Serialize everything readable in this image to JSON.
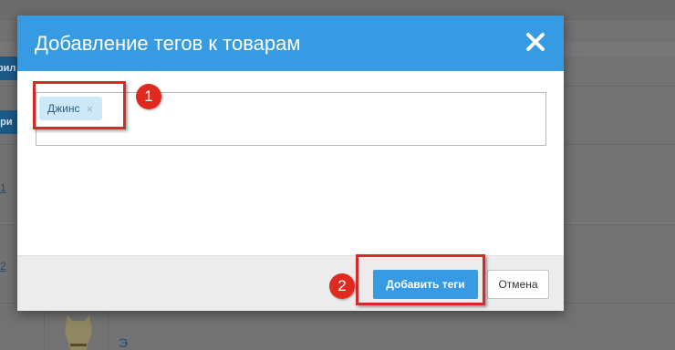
{
  "background": {
    "left_buttons": [
      "фил",
      "ери"
    ],
    "row_numbers": [
      "1",
      "2"
    ]
  },
  "modal": {
    "title": "Добавление тегов к товарам",
    "close_icon": "close-icon",
    "tags": [
      {
        "label": "Джинс",
        "remove_symbol": "×"
      }
    ],
    "footer": {
      "add_label": "Добавить теги",
      "cancel_label": "Отмена"
    }
  },
  "annotations": {
    "markers": [
      "1",
      "2"
    ],
    "color": "#d42a2a"
  },
  "colors": {
    "header": "#369be2",
    "primary_button": "#369be2",
    "tag_chip": "#cde8f6"
  }
}
